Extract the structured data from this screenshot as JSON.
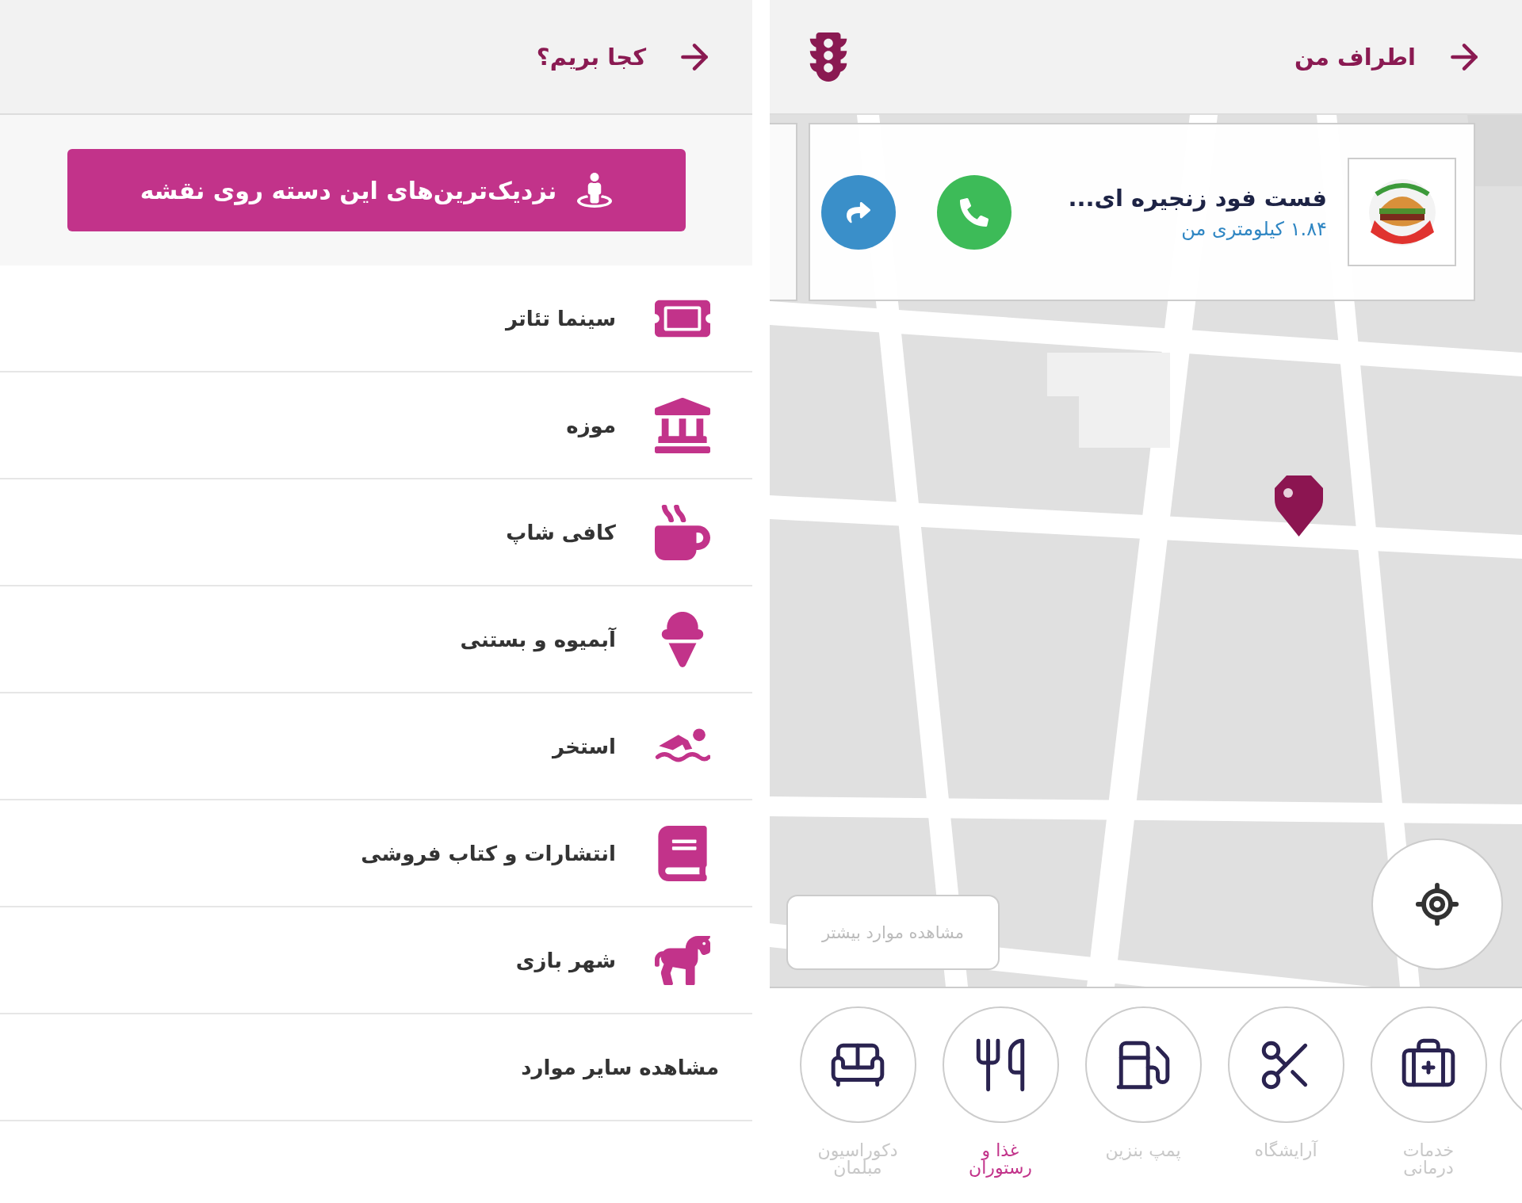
{
  "left_panel": {
    "header": {
      "title": "کجا بریم؟"
    },
    "nearest_button": {
      "label": "نزدیک‌ترین‌های این دسته روی نقشه"
    },
    "categories": [
      {
        "kind": "ticket",
        "label": "سینما تئاتر"
      },
      {
        "kind": "museum",
        "label": "موزه"
      },
      {
        "kind": "cafe",
        "label": "کافی شاپ"
      },
      {
        "kind": "icecream",
        "label": "آبمیوه و بستنی"
      },
      {
        "kind": "pool",
        "label": "استخر"
      },
      {
        "kind": "books",
        "label": "انتشارات و کتاب فروشی"
      },
      {
        "kind": "amusement",
        "label": "شهر بازی"
      }
    ],
    "more_link": "مشاهده سایر موارد"
  },
  "right_panel": {
    "header": {
      "title": "اطراف من"
    },
    "place_card": {
      "name": "فست فود زنجیره ای...",
      "distance": "۱.۸۴ کیلومتری من"
    },
    "more_button": "مشاهده موارد بیشتر",
    "category_bar": [
      {
        "kind": "medical",
        "label": "خدمات\nدرمانی",
        "selected": false
      },
      {
        "kind": "salon",
        "label": "آرایشگاه",
        "selected": false
      },
      {
        "kind": "fuel",
        "label": "پمپ بنزین",
        "selected": false
      },
      {
        "kind": "food",
        "label": "غذا و\nرستوران",
        "selected": true
      },
      {
        "kind": "furniture",
        "label": "دکوراسیون\nمبلمان",
        "selected": false
      }
    ]
  }
}
